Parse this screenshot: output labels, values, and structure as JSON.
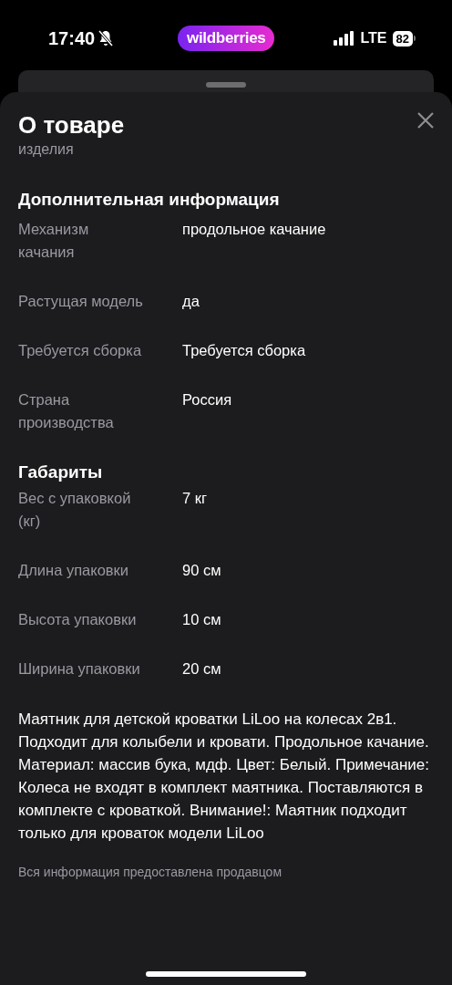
{
  "status_bar": {
    "time": "17:40",
    "silent": true,
    "logo": "wildberries",
    "network": "LTE",
    "battery": "82"
  },
  "sheet": {
    "title": "О товаре",
    "subtitle": "изделия",
    "sections": [
      {
        "heading": "Дополнительная информация",
        "rows": [
          {
            "label": "Механизм качания",
            "value": "продольное качание"
          },
          {
            "label": "Растущая модель",
            "value": "да"
          },
          {
            "label": "Требуется сборка",
            "value": "Требуется сборка"
          },
          {
            "label": "Страна производства",
            "value": "Россия"
          }
        ]
      },
      {
        "heading": "Габариты",
        "rows": [
          {
            "label": "Вес с упаковкой (кг)",
            "value": "7 кг"
          },
          {
            "label": "Длина упаковки",
            "value": "90 см"
          },
          {
            "label": "Высота упаковки",
            "value": "10 см"
          },
          {
            "label": "Ширина упаковки",
            "value": "20 см"
          }
        ]
      }
    ],
    "description": "Маятник для детской кроватки LiLoo на колесах 2в1. Подходит для колыбели и кровати. Продольное качание. Материал: массив бука, мдф. Цвет: Белый. Примечание: Колеса не входят в комплект маятника. Поставляются в комплекте с кроваткой. Внимание!: Маятник подходит только для кроваток модели LiLoo",
    "footer": "Вся информация предоставлена продавцом"
  }
}
